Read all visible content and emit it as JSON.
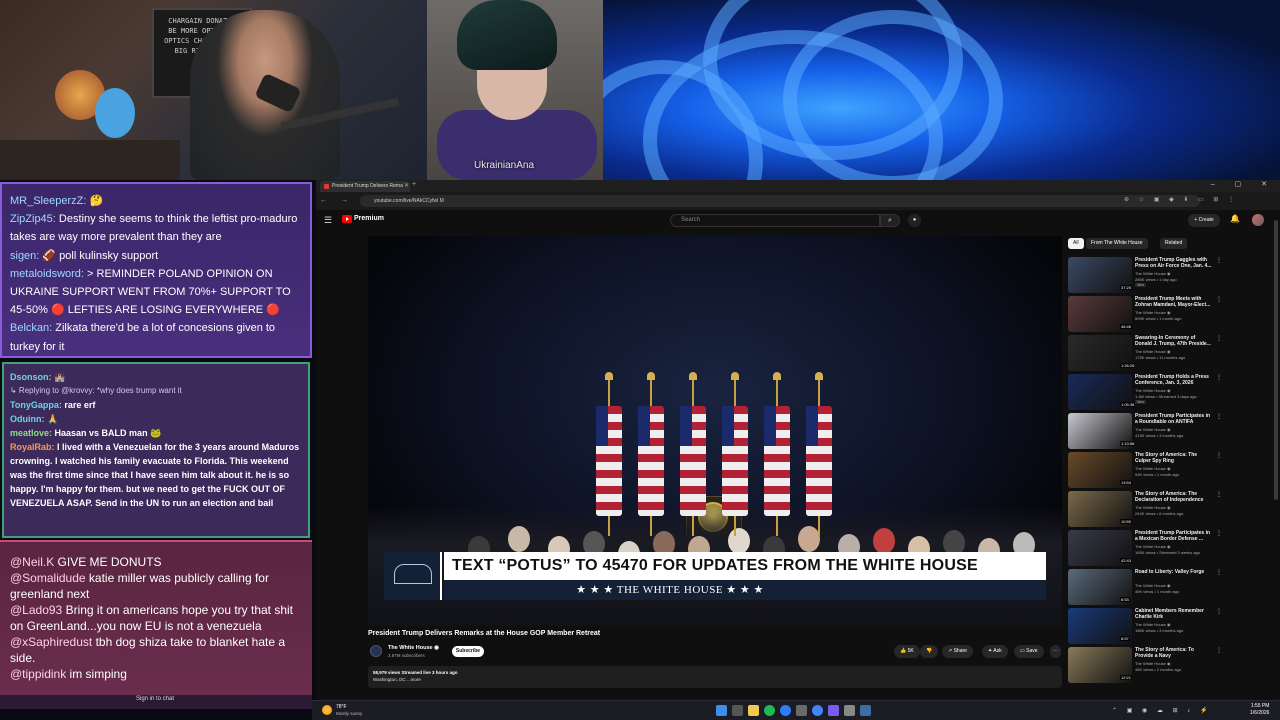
{
  "overlay": {
    "webcam_sign_lines": [
      "CHARGAIN DONATES",
      "BE MORE OPTIMIST",
      "OPTICS CHATTERS OF",
      "BIG RIGHT NOW"
    ],
    "guest_name": "UkrainianAna"
  },
  "chat_top": [
    {
      "user": "MR_SleeperzZ:",
      "text": " 🤔"
    },
    {
      "user": "ZipZip45:",
      "text": " Destiny she seems to think the leftist pro-maduro takes are way more prevalent than they are"
    },
    {
      "user": "sigen:",
      "text": " 🏈 poll kulinsky support"
    },
    {
      "user": "metaloidsword:",
      "text": " > REMINDER POLAND OPINION ON UKRAINE SUPPORT WENT FROM 70%+ SUPPORT TO 45-50% 🔴 LEFTIES ARE LOSING EVERYWHERE 🔴"
    },
    {
      "user": "Belckan:",
      "text": " Zilkata there'd be a lot of concesions given to turkey for it"
    }
  ],
  "chat_mid": [
    {
      "user": "Dsonson:",
      "text": " 🏰",
      "color": "u-cyan"
    },
    {
      "reply": "↳ Replying to @krovvy: *why does trump want it"
    },
    {
      "user": "TonyGappa:",
      "text": " rare erf",
      "color": "u-cyan"
    },
    {
      "user": "Oduinn:",
      "text": " 🙏",
      "color": "u-cyan"
    },
    {
      "user": "meatlove:",
      "text": " Haasan vs BALD man 🐸",
      "color": "u-green"
    },
    {
      "user": "RoyalRab:",
      "text": " I lived with a Venezuelan for the 3 years around Maduros crowning. I watched his family evacuate to Florida. This weekend was the first time since that I have seen him talk about it. he is so happy. I'm happy for them. but we need to get the FUCK OUT OF VENEZUELA ASAP. Send in the UN to run an election and bail",
      "color": "u-orange"
    }
  ],
  "chat_bot": [
    {
      "user": "@Neil.K",
      "text": " GIVE ME DONUTS"
    },
    {
      "user": "@Somalidude",
      "text": " katie miller was publicly calling for greenland next"
    },
    {
      "user": "@Lado93",
      "text": " Bring it on americans hope you try that shit on GreenLand...you now EU is not a venezuela"
    },
    {
      "user": "@xSaphiredust",
      "text": " tbh dog shiza take to blanket hate a side."
    },
    {
      "user": "@tippidink",
      "text": " im simping"
    }
  ],
  "chat_signin": "Sign in to chat",
  "browser": {
    "tab_title": "President Trump Delivers Rema",
    "url": "youtube.com/live/NAkCCyfwl M",
    "nav_icons": "← → ↻",
    "ext_icons": "⊕ ☆ ▣ ◆ ⬇ ▭ ⊞ ⋮",
    "window_controls": "– ▢ ✕"
  },
  "youtube": {
    "brand": "Premium",
    "search_placeholder": "Search",
    "create_label": "+ Create",
    "video_title": "President Trump Delivers Remarks at the House GOP Member Retreat",
    "channel_name": "The White House ◉",
    "channel_subs": "2.87M subscribers",
    "subscribe": "Subscribe",
    "likes": "👍 5K",
    "dislike": "👎",
    "share": "↗ Share",
    "ask": "✦ Ask",
    "save": "▭ Save",
    "more": "⋯",
    "desc_stats": "58,979 views  Streamed live 3 hours ago",
    "desc_location": "Washington, DC ...more",
    "lower_third_headline": "TEXT “POTUS” TO 45470 FOR UPDATES FROM THE WHITE HOUSE",
    "lower_third_sub": "★ ★ ★   THE WHITE HOUSE   ★ ★ ★",
    "chips": [
      "All",
      "From The White House",
      "Related"
    ],
    "recommendations": [
      {
        "title": "President Trump Gaggles with Press on Air Force One, Jan. 4...",
        "channel": "The White House ◉",
        "meta": "285K views • 1 day ago",
        "badge": "New",
        "duration": "37:25",
        "color": "#3a4a66"
      },
      {
        "title": "President Trump Meets with Zohran Mamdani, Mayor-Elect...",
        "channel": "The White House ◉",
        "meta": "809K views • 1 month ago",
        "badge": "",
        "duration": "46:46",
        "color": "#5a3a3a"
      },
      {
        "title": "Swearing-In Ceremony of Donald J. Trump, 47th Preside...",
        "channel": "The White House ◉",
        "meta": "175K views • 11 months ago",
        "badge": "",
        "duration": "1:26:26",
        "color": "#2a2a2a"
      },
      {
        "title": "President Trump Holds a Press Conference, Jan. 3, 2026",
        "channel": "The White House ◉",
        "meta": "1.4M views • Streamed 3 days ago",
        "badge": "New",
        "duration": "1:05:38",
        "color": "#1a2a5a"
      },
      {
        "title": "President Trump Participates in a Roundtable on ANTIFA",
        "channel": "The White House ◉",
        "meta": "413K views • 3 months ago",
        "badge": "",
        "duration": "1:13:58",
        "color": "#c8c8d0"
      },
      {
        "title": "The Story of America: The Culper Spy Ring",
        "channel": "The White House ◉",
        "meta": "94K views • 1 month ago",
        "badge": "",
        "duration": "13:54",
        "color": "#6a4a2a"
      },
      {
        "title": "The Story of America: The Declaration of Independence",
        "channel": "The White House ◉",
        "meta": "244K views • 6 months ago",
        "badge": "",
        "duration": "10:50",
        "color": "#7a6a4a"
      },
      {
        "title": "President Trump Participates in a Mexican Border Defense ...",
        "channel": "The White House ◉",
        "meta": "185K views • Streamed 3 weeks ago",
        "badge": "",
        "duration": "42:43",
        "color": "#3a3a4a"
      },
      {
        "title": "Road to Liberty: Valley Forge",
        "channel": "The White House ◉",
        "meta": "49K views • 1 month ago",
        "badge": "",
        "duration": "6:53",
        "color": "#5a6a7a"
      },
      {
        "title": "Cabinet Members Remember Charlie Kirk",
        "channel": "The White House ◉",
        "meta": "186K views • 3 months ago",
        "badge": "",
        "duration": "8:57",
        "color": "#1a3a7a"
      },
      {
        "title": "The Story of America: To Provide a Navy",
        "channel": "The White House ◉",
        "meta": "48K views • 2 months ago",
        "badge": "",
        "duration": "12:21",
        "color": "#8a7a5a"
      },
      {
        "title": "President Trump Delivers Remarks on Making Health ...",
        "channel": "The White House ◉",
        "meta": "",
        "badge": "",
        "duration": "",
        "color": "#7a2a3a"
      }
    ]
  },
  "taskbar": {
    "temp": "78°F",
    "weather": "Mostly sunny",
    "tray": "⌃ ▣ ◉ ☁ ⊞ ♪ ⚡",
    "time": "1:55 PM",
    "date": "1/6/2026"
  }
}
